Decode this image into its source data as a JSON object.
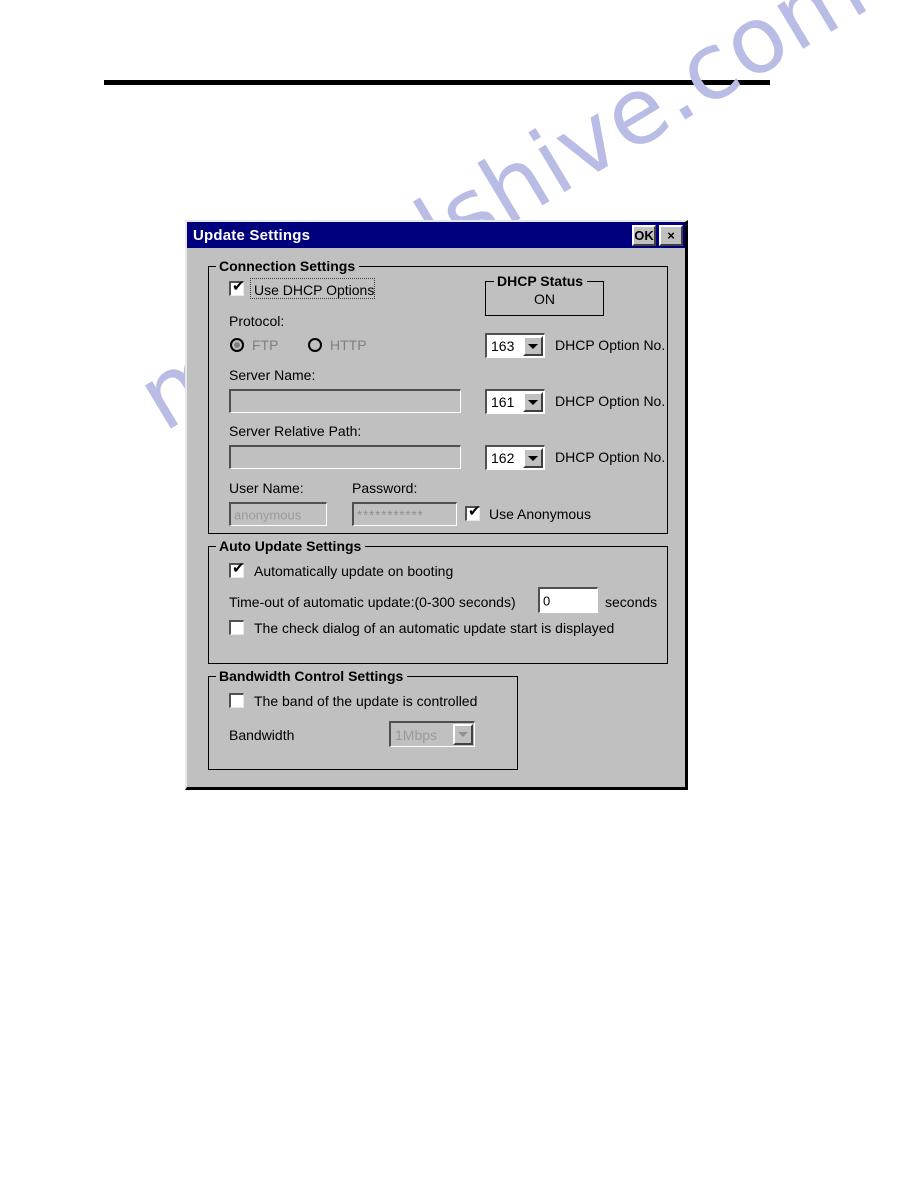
{
  "window": {
    "title": "Update Settings",
    "ok_label": "OK",
    "close_label": "×",
    "titlebar_color": "#00007f",
    "face_color": "#c0c0c0"
  },
  "watermark": {
    "text": "manualshive.com",
    "color": "#b9bce4"
  },
  "connection": {
    "group_title": "Connection Settings",
    "use_dhcp_options": {
      "label": "Use DHCP Options",
      "checked": true,
      "check_glyph": "✔"
    },
    "dhcp_status": {
      "group_title": "DHCP Status",
      "value": "ON"
    },
    "protocol": {
      "label": "Protocol:",
      "options": [
        {
          "label": "FTP",
          "selected": true,
          "disabled": true
        },
        {
          "label": "HTTP",
          "selected": false,
          "disabled": true
        }
      ]
    },
    "server_name": {
      "label": "Server Name:",
      "value": "",
      "placeholder": ""
    },
    "server_relative_path": {
      "label": "Server Relative Path:",
      "value": "",
      "placeholder": ""
    },
    "user_name": {
      "label": "User Name:",
      "value": "anonymous",
      "disabled": true
    },
    "password": {
      "label": "Password:",
      "value": "***********",
      "disabled": true
    },
    "use_anonymous": {
      "label": "Use Anonymous",
      "checked": true,
      "check_glyph": "✔"
    },
    "dhcp_options": [
      {
        "value": "163",
        "label": "DHCP Option No."
      },
      {
        "value": "161",
        "label": "DHCP Option No."
      },
      {
        "value": "162",
        "label": "DHCP Option No."
      }
    ]
  },
  "auto_update": {
    "group_title": "Auto Update Settings",
    "auto_on_boot": {
      "label": "Automatically update on booting",
      "checked": true,
      "check_glyph": "✔"
    },
    "timeout": {
      "label": "Time-out of automatic update:(0-300 seconds)",
      "value": "0",
      "unit": "seconds"
    },
    "check_dialog": {
      "label": "The check dialog of an automatic update start is displayed",
      "checked": false,
      "check_glyph": ""
    }
  },
  "bandwidth": {
    "group_title": "Bandwidth Control Settings",
    "band_controlled": {
      "label": "The band of the update is controlled",
      "checked": false,
      "check_glyph": ""
    },
    "bandwidth_label": "Bandwidth",
    "bandwidth_value": "1Mbps"
  }
}
